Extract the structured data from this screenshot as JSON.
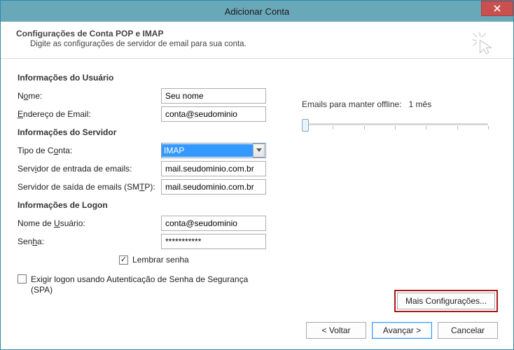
{
  "window": {
    "title": "Adicionar Conta"
  },
  "header": {
    "title": "Configurações de Conta POP e IMAP",
    "subtitle": "Digite as configurações de servidor de email para sua conta."
  },
  "sections": {
    "user": "Informações do Usuário",
    "server": "Informações do Servidor",
    "logon": "Informações de Logon"
  },
  "labels": {
    "name_pre": "N",
    "name_u": "o",
    "name_post": "me:",
    "email_u": "E",
    "email_post": "ndereço de Email:",
    "accttype_pre": "Tipo de C",
    "accttype_u": "o",
    "accttype_post": "nta:",
    "incoming_pre": "Serv",
    "incoming_u": "i",
    "incoming_post": "dor de entrada de emails:",
    "outgoing_pre": "Servidor de saída de emails (SM",
    "outgoing_u": "T",
    "outgoing_post": "P):",
    "user_pre": "Nome de ",
    "user_u": "U",
    "user_post": "suário:",
    "password_pre": "Sen",
    "password_u": "h",
    "password_post": "a:",
    "remember_u": "L",
    "remember_post": "embrar senha",
    "spa_pre": "E",
    "spa_u": "x",
    "spa_post": "igir logon usando Autenticação de Senha de Segurança (SPA)"
  },
  "fields": {
    "name": "Seu nome",
    "email": "conta@seudominio",
    "account_type": "IMAP",
    "incoming": "mail.seudominio.com.br",
    "outgoing": "mail.seudominio.com.br",
    "username": "conta@seudominio",
    "password": "***********",
    "remember_checked": true,
    "spa_checked": false
  },
  "offline": {
    "label": "Emails para manter offline:",
    "value": "1 mês"
  },
  "buttons": {
    "more_pre": "M",
    "more_u": "a",
    "more_post": "is Configurações...",
    "back": "< Voltar",
    "next_pre": "Ava",
    "next_u": "n",
    "next_post": "çar >",
    "cancel": "Cancelar"
  }
}
